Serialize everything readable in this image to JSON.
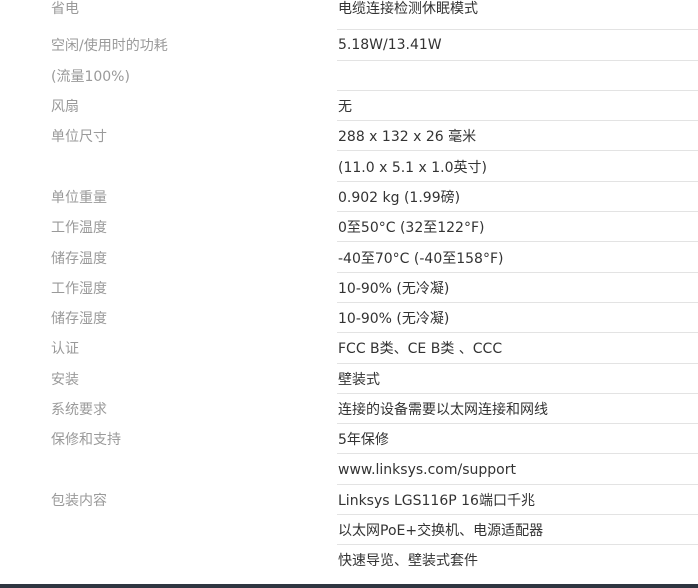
{
  "specs": {
    "rows": [
      {
        "label": "省电",
        "value": "电缆连接检测休眠模式"
      },
      {
        "label": "空闲/使用时的功耗",
        "value": "5.18W/13.41W"
      },
      {
        "label": "(流量100%)",
        "value": ""
      },
      {
        "label": "风扇",
        "value": "无"
      },
      {
        "label": "单位尺寸",
        "value": "288 x 132 x 26 毫米"
      },
      {
        "label": "",
        "value": "(11.0 x 5.1 x 1.0英寸)"
      },
      {
        "label": "单位重量",
        "value": "0.902 kg (1.99磅)"
      },
      {
        "label": "工作温度",
        "value": "0至50°C (32至122°F)"
      },
      {
        "label": "储存温度",
        "value": "-40至70°C (-40至158°F)"
      },
      {
        "label": "工作湿度",
        "value": "10-90% (无冷凝)"
      },
      {
        "label": "储存湿度",
        "value": "10-90% (无冷凝)"
      },
      {
        "label": "认证",
        "value": "FCC B类、CE B类 、CCC"
      },
      {
        "label": "安装",
        "value": "壁装式"
      },
      {
        "label": "系统要求",
        "value": "连接的设备需要以太网连接和网线"
      },
      {
        "label": "保修和支持",
        "value": "5年保修"
      },
      {
        "label": "",
        "value": "www.linksys.com/support"
      },
      {
        "label": "包装内容",
        "value": "Linksys LGS116P 16端口千兆"
      },
      {
        "label": "",
        "value": "以太网PoE+交换机、电源适配器"
      },
      {
        "label": "",
        "value": "快速导览、壁装式套件"
      }
    ]
  },
  "colors": {
    "label_text": "#9a9a9a",
    "value_text": "#333333",
    "divider": "#e3e3e3",
    "bottom_bar": "#2e3540"
  }
}
